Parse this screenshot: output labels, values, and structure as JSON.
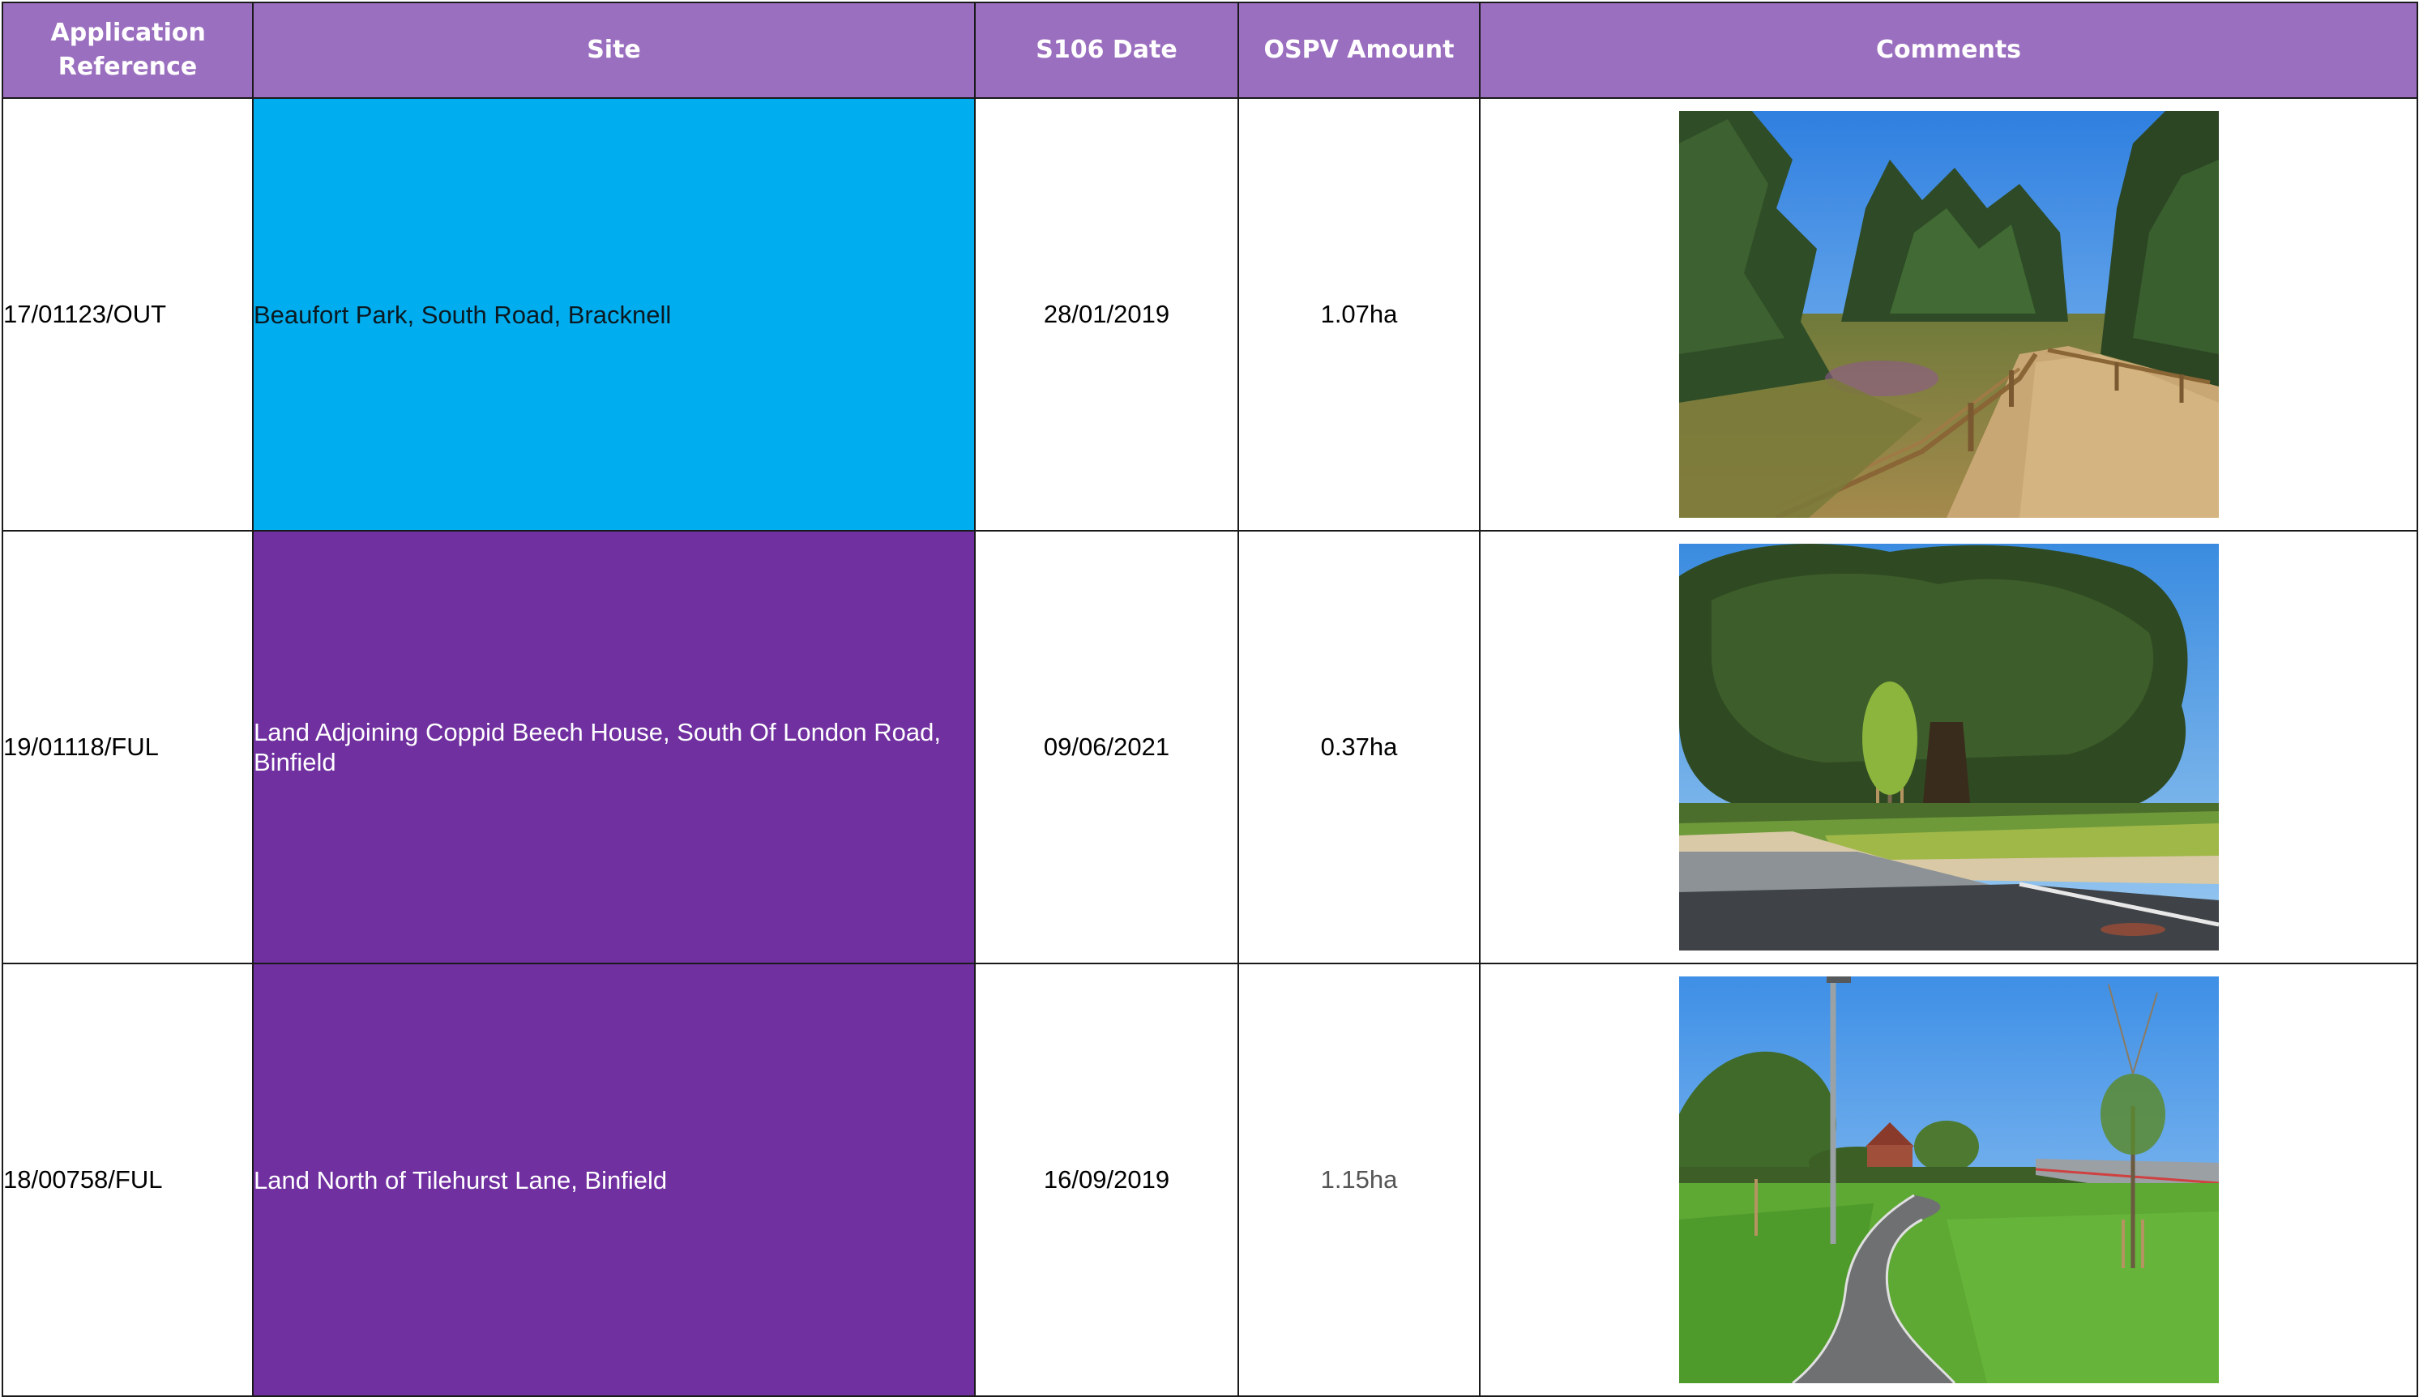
{
  "table": {
    "headers": {
      "reference": "Application Reference",
      "site": "Site",
      "s106_date": "S106 Date",
      "ospv_amount": "OSPV Amount",
      "comments": "Comments"
    },
    "rows": [
      {
        "reference": "17/01123/OUT",
        "site": "Beaufort Park, South Road, Bracknell",
        "s106_date": "28/01/2019",
        "ospv_amount": "1.07ha",
        "site_color": "#00aeef",
        "comment_photo": "woodland-path-with-fence"
      },
      {
        "reference": "19/01118/FUL",
        "site": "Land Adjoining Coppid Beech House, South Of London Road, Binfield",
        "s106_date": "09/06/2021",
        "ospv_amount": "0.37ha",
        "site_color": "#7030a0",
        "comment_photo": "oak-tree-and-planting-by-road"
      },
      {
        "reference": "18/00758/FUL",
        "site": "Land North of Tilehurst Lane, Binfield",
        "s106_date": "16/09/2019",
        "ospv_amount": "1.15ha",
        "site_color": "#7030a0",
        "comment_photo": "footpath-through-open-space"
      }
    ]
  },
  "colors": {
    "header_background": "#9b6fbf",
    "header_text": "#ffffff",
    "cyan_site": "#00aeef",
    "purple_site": "#7030a0"
  }
}
